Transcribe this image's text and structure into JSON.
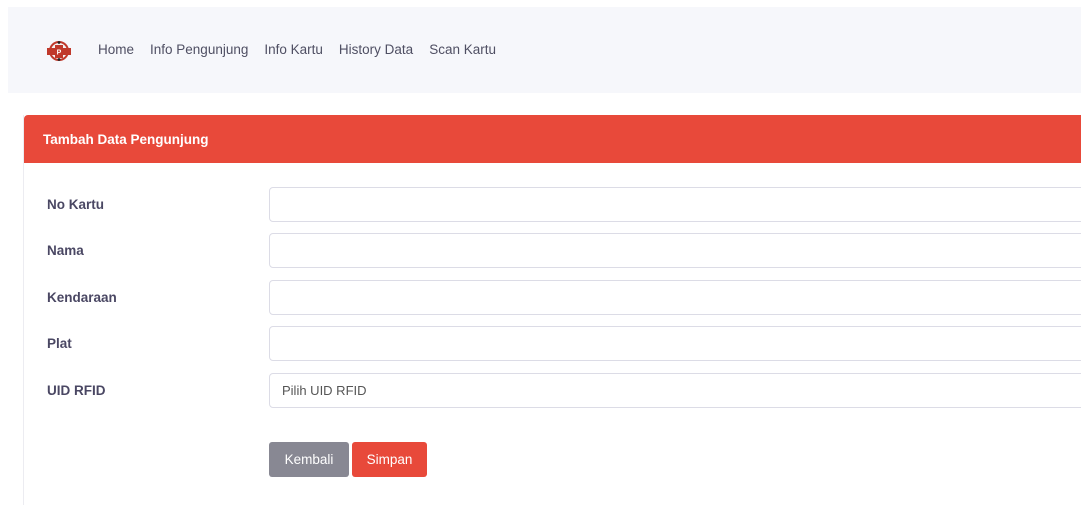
{
  "navbar": {
    "logo": "brand-logo-icon",
    "links": [
      "Home",
      "Info Pengunjung",
      "Info Kartu",
      "History Data",
      "Scan Kartu"
    ]
  },
  "card": {
    "title": "Tambah Data Pengunjung",
    "header_color": "#e8493a"
  },
  "form": {
    "no_kartu_label": "No Kartu",
    "no_kartu_value": "",
    "nama_label": "Nama",
    "nama_value": "",
    "kendaraan_label": "Kendaraan",
    "kendaraan_value": "",
    "plat_label": "Plat",
    "plat_value": "",
    "uid_label": "UID RFID",
    "uid_selected": "Pilih UID RFID"
  },
  "buttons": {
    "back_label": "Kembali",
    "save_label": "Simpan",
    "back_color": "#888893",
    "save_color": "#e8493a"
  }
}
